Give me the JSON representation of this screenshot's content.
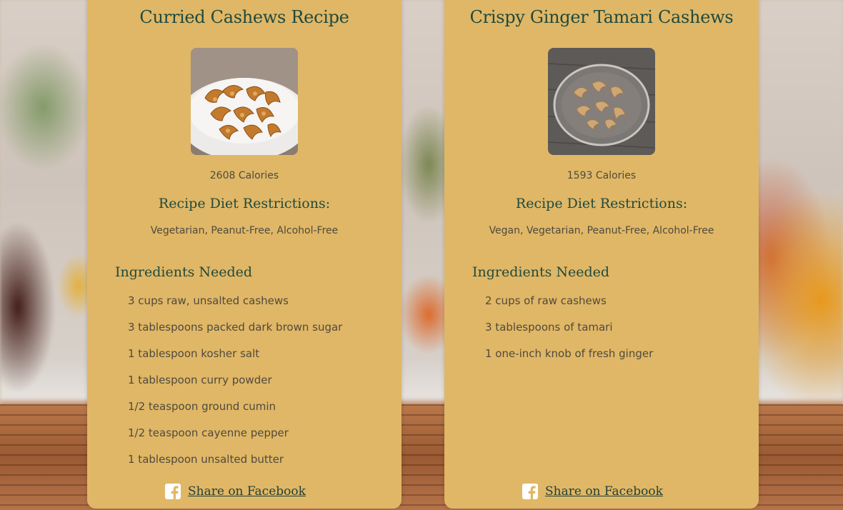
{
  "recipes": [
    {
      "title": "Curried Cashews Recipe",
      "calories": "2608 Calories",
      "diet_heading": "Recipe Diet Restrictions:",
      "diet_restrictions": "Vegetarian, Peanut-Free, Alcohol-Free",
      "ingredients_heading": "Ingredients Needed",
      "ingredients": [
        "3 cups raw, unsalted cashews",
        "3 tablespoons packed dark brown sugar",
        "1 tablespoon kosher salt",
        "1 tablespoon curry powder",
        "1/2 teaspoon ground cumin",
        "1/2 teaspoon cayenne pepper",
        "1 tablespoon unsalted butter"
      ],
      "share_label": "Share on Facebook",
      "image_icon": "curried-cashews-photo"
    },
    {
      "title": "Crispy Ginger Tamari Cashews",
      "calories": "1593 Calories",
      "diet_heading": "Recipe Diet Restrictions:",
      "diet_restrictions": "Vegan, Vegetarian, Peanut-Free, Alcohol-Free",
      "ingredients_heading": "Ingredients Needed",
      "ingredients": [
        "2 cups of raw cashews",
        "3 tablespoons of tamari",
        "1 one-inch knob of fresh ginger"
      ],
      "share_label": "Share on Facebook",
      "image_icon": "tamari-cashews-photo"
    }
  ],
  "colors": {
    "card_background": "#e0b766",
    "heading": "#1f4a3e",
    "body_text": "#4f4a3e"
  },
  "icons": {
    "share": "facebook-icon"
  }
}
